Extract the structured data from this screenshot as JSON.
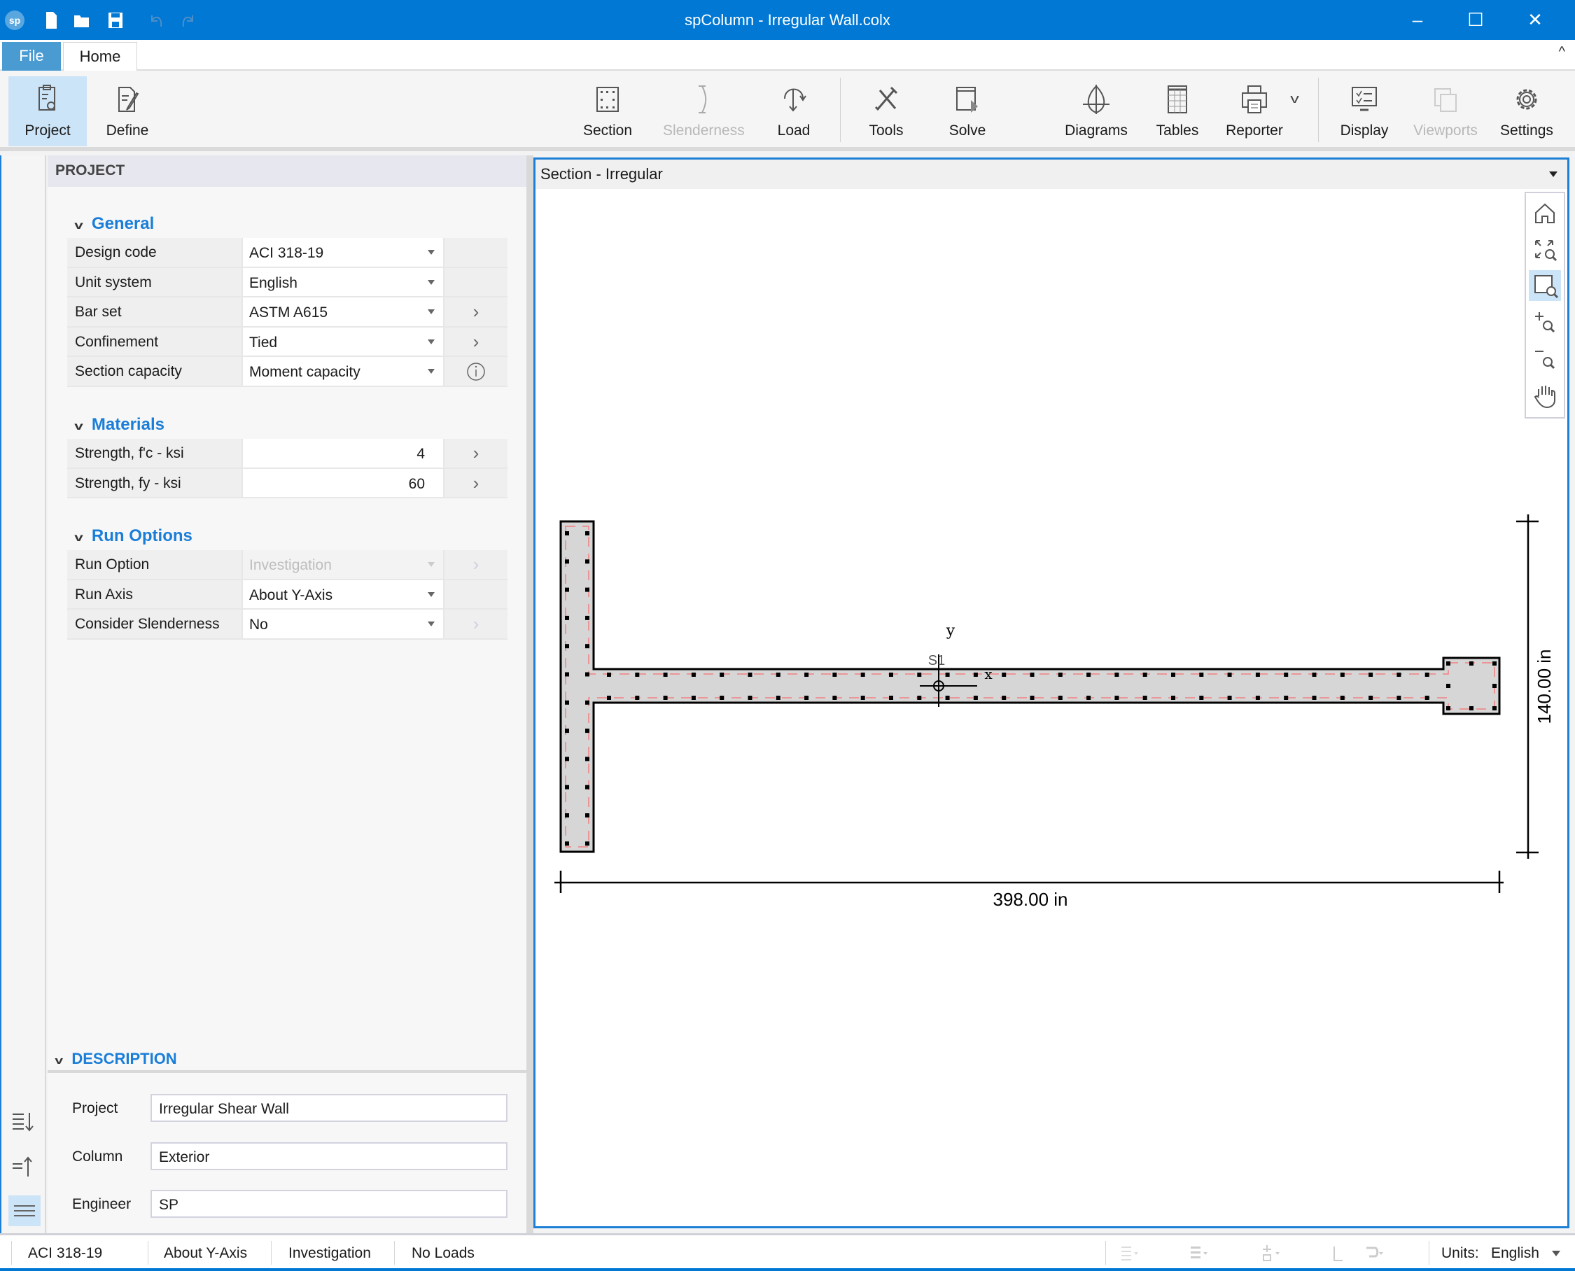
{
  "window": {
    "title": "spColumn - Irregular Wall.colx"
  },
  "quick_access": [
    "app-logo-icon",
    "new-file-icon",
    "open-folder-icon",
    "save-icon",
    "undo-icon",
    "redo-icon"
  ],
  "tabs": {
    "file": "File",
    "home": "Home"
  },
  "ribbon": {
    "project": "Project",
    "define": "Define",
    "section": "Section",
    "slenderness": "Slenderness",
    "load": "Load",
    "tools": "Tools",
    "solve": "Solve",
    "diagrams": "Diagrams",
    "tables": "Tables",
    "reporter": "Reporter",
    "display": "Display",
    "viewports": "Viewports",
    "settings": "Settings"
  },
  "panel": {
    "title": "PROJECT",
    "general": {
      "header": "General",
      "rows": [
        {
          "label": "Design code",
          "value": "ACI 318-19"
        },
        {
          "label": "Unit system",
          "value": "English"
        },
        {
          "label": "Bar set",
          "value": "ASTM A615"
        },
        {
          "label": "Confinement",
          "value": "Tied"
        },
        {
          "label": "Section capacity",
          "value": "Moment capacity"
        }
      ]
    },
    "materials": {
      "header": "Materials",
      "rows": [
        {
          "label": "Strength, f'c - ksi",
          "value": "4"
        },
        {
          "label": "Strength, fy  - ksi",
          "value": "60"
        }
      ]
    },
    "run_options": {
      "header": "Run Options",
      "rows": [
        {
          "label": "Run Option",
          "value": "Investigation"
        },
        {
          "label": "Run Axis",
          "value": "About Y-Axis"
        },
        {
          "label": "Consider Slenderness",
          "value": "No"
        }
      ]
    },
    "description": {
      "header": "DESCRIPTION",
      "project_label": "Project",
      "project_value": "Irregular Shear Wall",
      "column_label": "Column",
      "column_value": "Exterior",
      "engineer_label": "Engineer",
      "engineer_value": "SP"
    }
  },
  "canvas": {
    "title": "Section - Irregular",
    "width_dim": "398.00 in",
    "height_dim": "140.00 in",
    "axis_y": "y",
    "axis_x": "x",
    "solid_label": "S1",
    "colors": {
      "concrete": "#d6d6d6",
      "outline": "#000000",
      "cover": "#f08080",
      "bars": "#000000"
    }
  },
  "status": {
    "code": "ACI 318-19",
    "axis": "About Y-Axis",
    "run": "Investigation",
    "loads": "No Loads",
    "units_label": "Units:",
    "units_value": "English"
  },
  "colors": {
    "accent": "#0078d4",
    "section_header": "#1a7ed8",
    "selected": "#cce4f7"
  }
}
